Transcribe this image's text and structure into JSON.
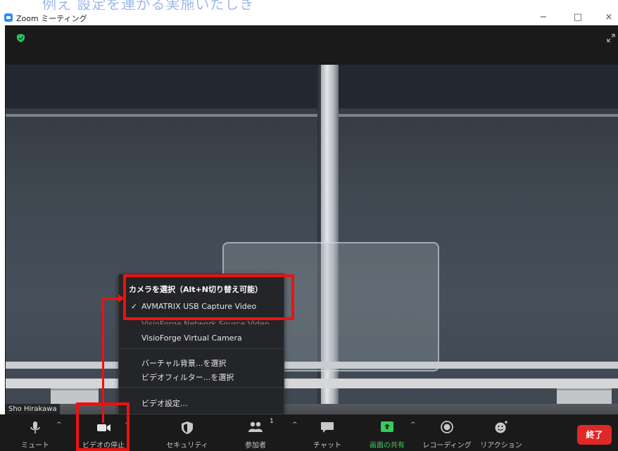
{
  "caption": "例え    設定を連かる実施いたしき",
  "window": {
    "title": "Zoom ミーティング",
    "minimize": "−",
    "maximize": "□",
    "close": "×"
  },
  "video": {
    "participant_name": "Sho Hirakawa"
  },
  "camera_menu": {
    "header": "カメラを選択（Alt+N切り替え可能）",
    "items": [
      {
        "label": "AVMATRIX USB Capture Video",
        "checked": true
      },
      {
        "label": "VisioForge Network Source Video",
        "checked": false
      },
      {
        "label": "VisioForge Virtual Camera",
        "checked": false
      },
      {
        "label": "バーチャル背景...を選択",
        "checked": false
      },
      {
        "label": "ビデオフィルター...を選択",
        "checked": false
      },
      {
        "label": "ビデオ設定...",
        "checked": false
      }
    ],
    "check_mark": "✓"
  },
  "toolbar": {
    "mute": "ミュート",
    "video_stop": "ビデオの停止",
    "security": "セキュリティ",
    "participants": "参加者",
    "participants_count": "1",
    "chat": "チャット",
    "share_screen": "画面の共有",
    "record": "レコーディング",
    "reactions": "リアクション",
    "end": "終了",
    "caret": "^"
  },
  "colors": {
    "accent_blue": "#2d8cff",
    "share_green": "#3acb5a",
    "end_red": "#e02828",
    "annotation_red": "#ee1111"
  }
}
